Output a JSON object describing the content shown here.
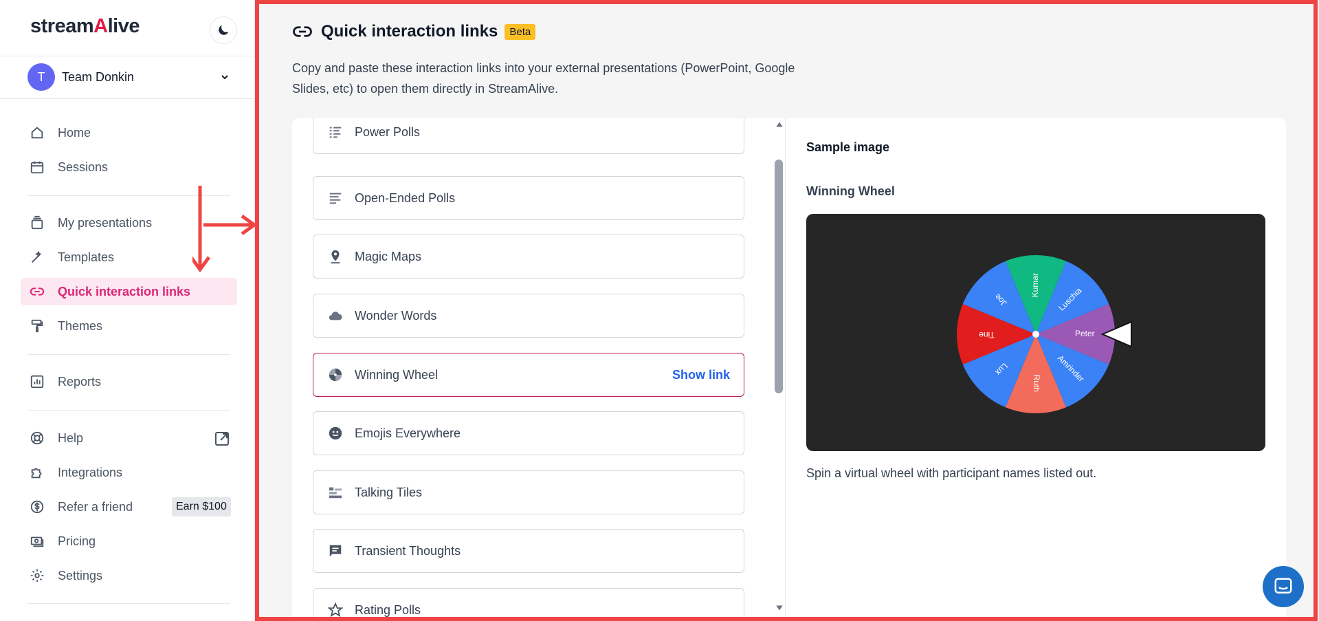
{
  "brand": {
    "name_pre": "stream",
    "name_accent": "A",
    "name_post": "live"
  },
  "team": {
    "initial": "T",
    "name": "Team Donkin"
  },
  "nav": {
    "home": "Home",
    "sessions": "Sessions",
    "presentations": "My presentations",
    "templates": "Templates",
    "quick_links": "Quick interaction links",
    "themes": "Themes",
    "reports": "Reports",
    "help": "Help",
    "integrations": "Integrations",
    "refer": "Refer a friend",
    "refer_badge": "Earn $100",
    "pricing": "Pricing",
    "settings": "Settings"
  },
  "header": {
    "title": "Quick interaction links",
    "badge": "Beta",
    "description": "Copy and paste these interaction links into your external presentations (PowerPoint, Google Slides, etc) to open them directly in StreamAlive."
  },
  "interactions": [
    {
      "label": "Power Polls",
      "icon": "bars-icon"
    },
    {
      "label": "Open-Ended Polls",
      "icon": "lines-icon"
    },
    {
      "label": "Magic Maps",
      "icon": "map-pin-icon"
    },
    {
      "label": "Wonder Words",
      "icon": "cloud-icon"
    },
    {
      "label": "Winning Wheel",
      "icon": "wheel-icon",
      "action": "Show link"
    },
    {
      "label": "Emojis Everywhere",
      "icon": "smiley-icon"
    },
    {
      "label": "Talking Tiles",
      "icon": "tiles-icon"
    },
    {
      "label": "Transient Thoughts",
      "icon": "chat-icon"
    },
    {
      "label": "Rating Polls",
      "icon": "star-icon"
    }
  ],
  "sample": {
    "heading": "Sample image",
    "name": "Winning Wheel",
    "caption": "Spin a virtual wheel with participant names listed out.",
    "wheel_names": [
      "Kumar",
      "Luschia",
      "Peter",
      "Amrinder",
      "Ruth",
      "Lux",
      "Tine",
      "Joe"
    ],
    "wheel_colors": [
      "#10b981",
      "#3b82f6",
      "#9b59b6",
      "#3b82f6",
      "#f26b5b",
      "#3b82f6",
      "#e11d1d",
      "#3b82f6"
    ]
  },
  "colors": {
    "accent": "#db2777",
    "link": "#2563eb",
    "beta": "#fbbf24",
    "frame": "#ef4444"
  }
}
